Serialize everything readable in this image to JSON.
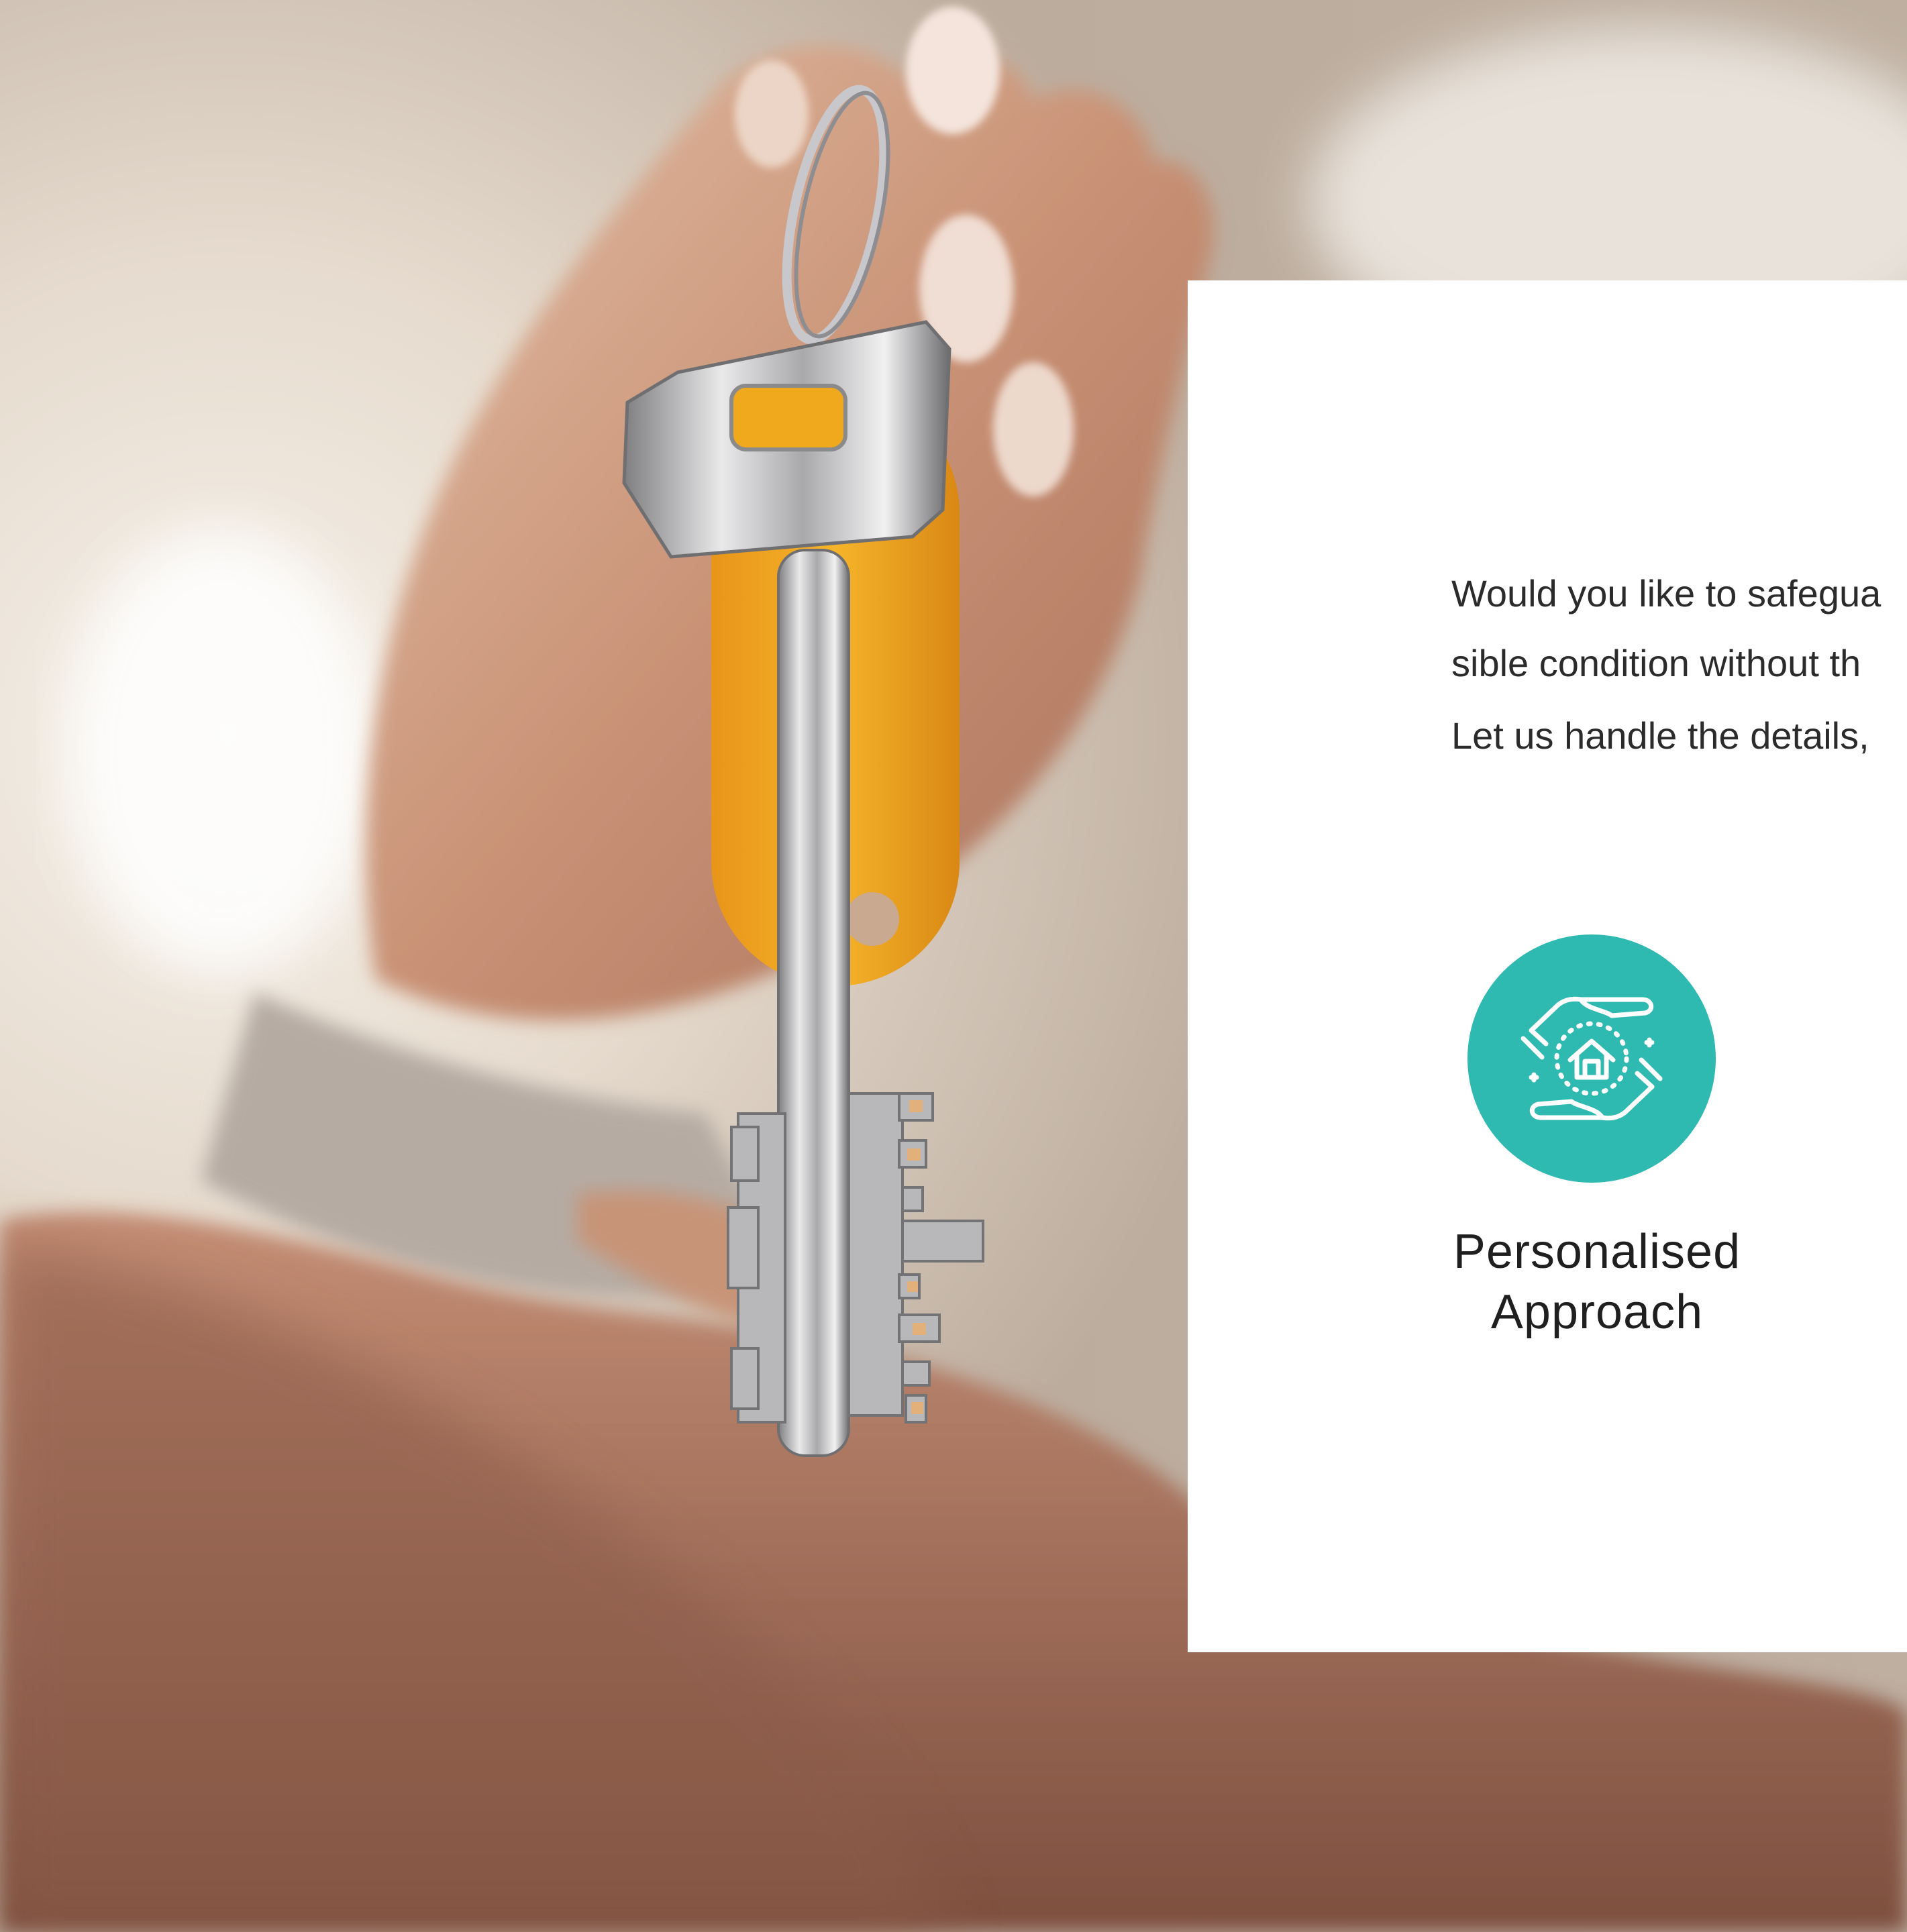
{
  "card": {
    "paragraph_line_1": "Would you like to safegua",
    "paragraph_line_2": "sible condition without th",
    "paragraph_line_3": "Let us handle the details,"
  },
  "feature": {
    "icon": "hands-house-care-icon",
    "title_line_1": "Personalised",
    "title_line_2": "Approach"
  },
  "photo": {
    "subject": "hand-holding-key-photo"
  },
  "colors": {
    "accent": "#2fbab1",
    "card_bg": "#ffffff",
    "text": "#2b2b2b",
    "key_tag": "#f0a81c"
  }
}
